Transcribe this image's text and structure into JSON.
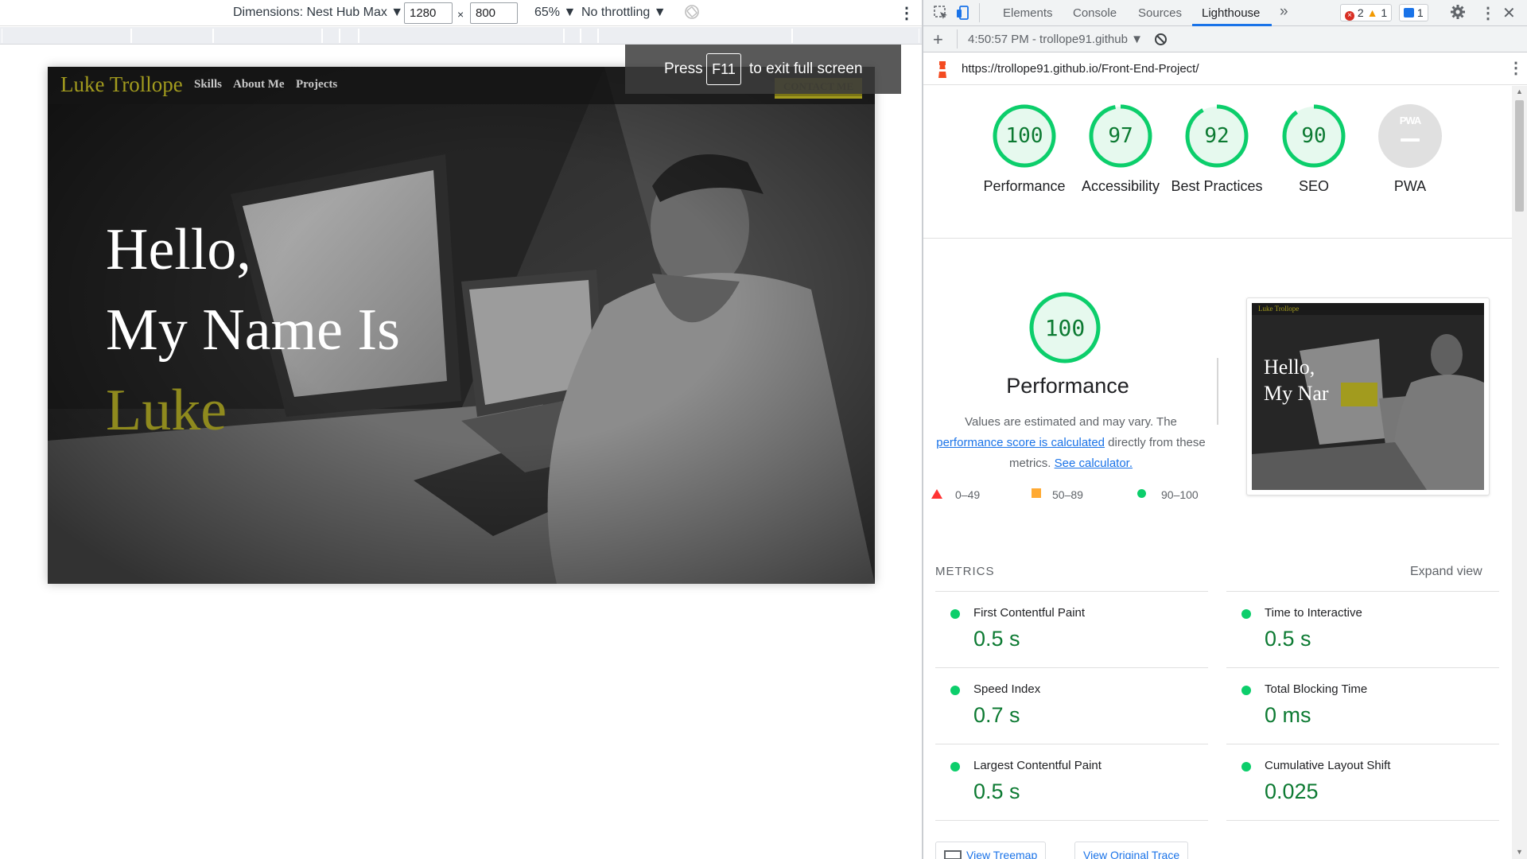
{
  "device_toolbar": {
    "dimensions_label": "Dimensions: Nest Hub Max",
    "width_value": "1280",
    "height_value": "800",
    "times_sign": "×",
    "zoom": "65%",
    "throttling": "No throttling"
  },
  "fullscreen_notice": {
    "press": "Press",
    "key": "F11",
    "rest": "to exit full screen"
  },
  "site": {
    "logo": "Luke Trollope",
    "nav": [
      "Skills",
      "About Me",
      "Projects"
    ],
    "contact": "CONTACT ME",
    "hero_line1": "Hello,",
    "hero_line2": "My Name Is",
    "hero_name": "Luke",
    "accent_color": "#a29b1e"
  },
  "devtools": {
    "tabs": [
      "Elements",
      "Console",
      "Sources",
      "Lighthouse"
    ],
    "active_tab": "Lighthouse",
    "more_tabs": "»",
    "errors": "2",
    "warnings": "1",
    "messages": "1",
    "report_time": "4:50:57 PM - trollope91.github",
    "url": "https://trollope91.github.io/Front-End-Project/"
  },
  "scores": [
    {
      "label": "Performance",
      "value": "100",
      "fraction": 1.0
    },
    {
      "label": "Accessibility",
      "value": "97",
      "fraction": 0.97
    },
    {
      "label": "Best Practices",
      "value": "92",
      "fraction": 0.92
    },
    {
      "label": "SEO",
      "value": "90",
      "fraction": 0.9
    },
    {
      "label": "PWA",
      "value": "",
      "badge": "PWA"
    }
  ],
  "performance": {
    "score": "100",
    "title": "Performance",
    "desc_part1": "Values are estimated and may vary. The ",
    "desc_link1": "performance score is calculated",
    "desc_part2": " directly from these metrics. ",
    "desc_link2": "See calculator.",
    "legend": [
      "0–49",
      "50–89",
      "90–100"
    ],
    "legend_colors": [
      "#ff3333",
      "#ffaa33",
      "#0cce6b"
    ]
  },
  "thumbnail": {
    "logo": "Luke Trollope",
    "line1": "Hello,",
    "line2": "My Nar"
  },
  "metrics": {
    "title": "METRICS",
    "expand": "Expand view",
    "items": [
      {
        "name": "First Contentful Paint",
        "value": "0.5 s"
      },
      {
        "name": "Time to Interactive",
        "value": "0.5 s"
      },
      {
        "name": "Speed Index",
        "value": "0.7 s"
      },
      {
        "name": "Total Blocking Time",
        "value": "0 ms"
      },
      {
        "name": "Largest Contentful Paint",
        "value": "0.5 s"
      },
      {
        "name": "Cumulative Layout Shift",
        "value": "0.025"
      }
    ]
  },
  "buttons": {
    "treemap": "View Treemap",
    "trace": "View Original Trace"
  },
  "colors": {
    "pass": "#0cce6b",
    "pass_text": "#0c7a32",
    "link": "#1a73e8"
  }
}
